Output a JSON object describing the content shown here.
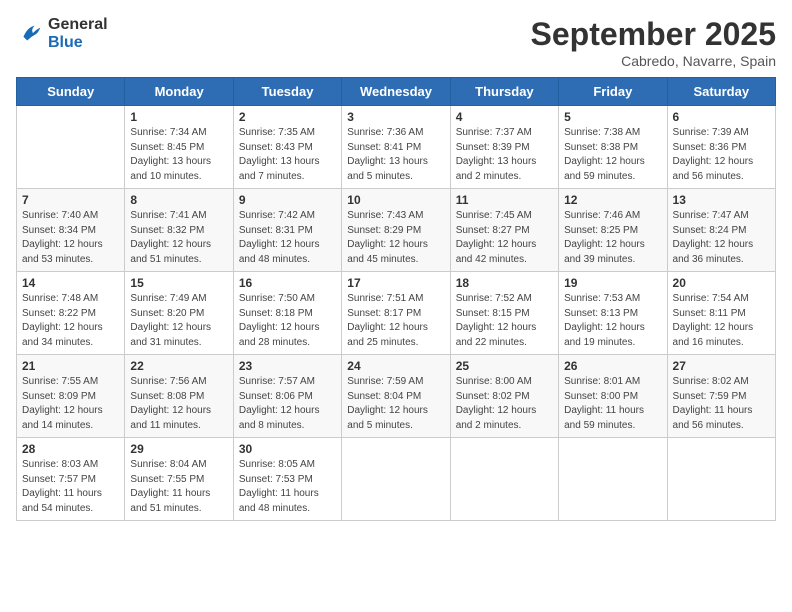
{
  "header": {
    "logo_line1": "General",
    "logo_line2": "Blue",
    "month": "September 2025",
    "location": "Cabredo, Navarre, Spain"
  },
  "days_of_week": [
    "Sunday",
    "Monday",
    "Tuesday",
    "Wednesday",
    "Thursday",
    "Friday",
    "Saturday"
  ],
  "weeks": [
    [
      {
        "day": "",
        "sunrise": "",
        "sunset": "",
        "daylight": ""
      },
      {
        "day": "1",
        "sunrise": "Sunrise: 7:34 AM",
        "sunset": "Sunset: 8:45 PM",
        "daylight": "Daylight: 13 hours and 10 minutes."
      },
      {
        "day": "2",
        "sunrise": "Sunrise: 7:35 AM",
        "sunset": "Sunset: 8:43 PM",
        "daylight": "Daylight: 13 hours and 7 minutes."
      },
      {
        "day": "3",
        "sunrise": "Sunrise: 7:36 AM",
        "sunset": "Sunset: 8:41 PM",
        "daylight": "Daylight: 13 hours and 5 minutes."
      },
      {
        "day": "4",
        "sunrise": "Sunrise: 7:37 AM",
        "sunset": "Sunset: 8:39 PM",
        "daylight": "Daylight: 13 hours and 2 minutes."
      },
      {
        "day": "5",
        "sunrise": "Sunrise: 7:38 AM",
        "sunset": "Sunset: 8:38 PM",
        "daylight": "Daylight: 12 hours and 59 minutes."
      },
      {
        "day": "6",
        "sunrise": "Sunrise: 7:39 AM",
        "sunset": "Sunset: 8:36 PM",
        "daylight": "Daylight: 12 hours and 56 minutes."
      }
    ],
    [
      {
        "day": "7",
        "sunrise": "Sunrise: 7:40 AM",
        "sunset": "Sunset: 8:34 PM",
        "daylight": "Daylight: 12 hours and 53 minutes."
      },
      {
        "day": "8",
        "sunrise": "Sunrise: 7:41 AM",
        "sunset": "Sunset: 8:32 PM",
        "daylight": "Daylight: 12 hours and 51 minutes."
      },
      {
        "day": "9",
        "sunrise": "Sunrise: 7:42 AM",
        "sunset": "Sunset: 8:31 PM",
        "daylight": "Daylight: 12 hours and 48 minutes."
      },
      {
        "day": "10",
        "sunrise": "Sunrise: 7:43 AM",
        "sunset": "Sunset: 8:29 PM",
        "daylight": "Daylight: 12 hours and 45 minutes."
      },
      {
        "day": "11",
        "sunrise": "Sunrise: 7:45 AM",
        "sunset": "Sunset: 8:27 PM",
        "daylight": "Daylight: 12 hours and 42 minutes."
      },
      {
        "day": "12",
        "sunrise": "Sunrise: 7:46 AM",
        "sunset": "Sunset: 8:25 PM",
        "daylight": "Daylight: 12 hours and 39 minutes."
      },
      {
        "day": "13",
        "sunrise": "Sunrise: 7:47 AM",
        "sunset": "Sunset: 8:24 PM",
        "daylight": "Daylight: 12 hours and 36 minutes."
      }
    ],
    [
      {
        "day": "14",
        "sunrise": "Sunrise: 7:48 AM",
        "sunset": "Sunset: 8:22 PM",
        "daylight": "Daylight: 12 hours and 34 minutes."
      },
      {
        "day": "15",
        "sunrise": "Sunrise: 7:49 AM",
        "sunset": "Sunset: 8:20 PM",
        "daylight": "Daylight: 12 hours and 31 minutes."
      },
      {
        "day": "16",
        "sunrise": "Sunrise: 7:50 AM",
        "sunset": "Sunset: 8:18 PM",
        "daylight": "Daylight: 12 hours and 28 minutes."
      },
      {
        "day": "17",
        "sunrise": "Sunrise: 7:51 AM",
        "sunset": "Sunset: 8:17 PM",
        "daylight": "Daylight: 12 hours and 25 minutes."
      },
      {
        "day": "18",
        "sunrise": "Sunrise: 7:52 AM",
        "sunset": "Sunset: 8:15 PM",
        "daylight": "Daylight: 12 hours and 22 minutes."
      },
      {
        "day": "19",
        "sunrise": "Sunrise: 7:53 AM",
        "sunset": "Sunset: 8:13 PM",
        "daylight": "Daylight: 12 hours and 19 minutes."
      },
      {
        "day": "20",
        "sunrise": "Sunrise: 7:54 AM",
        "sunset": "Sunset: 8:11 PM",
        "daylight": "Daylight: 12 hours and 16 minutes."
      }
    ],
    [
      {
        "day": "21",
        "sunrise": "Sunrise: 7:55 AM",
        "sunset": "Sunset: 8:09 PM",
        "daylight": "Daylight: 12 hours and 14 minutes."
      },
      {
        "day": "22",
        "sunrise": "Sunrise: 7:56 AM",
        "sunset": "Sunset: 8:08 PM",
        "daylight": "Daylight: 12 hours and 11 minutes."
      },
      {
        "day": "23",
        "sunrise": "Sunrise: 7:57 AM",
        "sunset": "Sunset: 8:06 PM",
        "daylight": "Daylight: 12 hours and 8 minutes."
      },
      {
        "day": "24",
        "sunrise": "Sunrise: 7:59 AM",
        "sunset": "Sunset: 8:04 PM",
        "daylight": "Daylight: 12 hours and 5 minutes."
      },
      {
        "day": "25",
        "sunrise": "Sunrise: 8:00 AM",
        "sunset": "Sunset: 8:02 PM",
        "daylight": "Daylight: 12 hours and 2 minutes."
      },
      {
        "day": "26",
        "sunrise": "Sunrise: 8:01 AM",
        "sunset": "Sunset: 8:00 PM",
        "daylight": "Daylight: 11 hours and 59 minutes."
      },
      {
        "day": "27",
        "sunrise": "Sunrise: 8:02 AM",
        "sunset": "Sunset: 7:59 PM",
        "daylight": "Daylight: 11 hours and 56 minutes."
      }
    ],
    [
      {
        "day": "28",
        "sunrise": "Sunrise: 8:03 AM",
        "sunset": "Sunset: 7:57 PM",
        "daylight": "Daylight: 11 hours and 54 minutes."
      },
      {
        "day": "29",
        "sunrise": "Sunrise: 8:04 AM",
        "sunset": "Sunset: 7:55 PM",
        "daylight": "Daylight: 11 hours and 51 minutes."
      },
      {
        "day": "30",
        "sunrise": "Sunrise: 8:05 AM",
        "sunset": "Sunset: 7:53 PM",
        "daylight": "Daylight: 11 hours and 48 minutes."
      },
      {
        "day": "",
        "sunrise": "",
        "sunset": "",
        "daylight": ""
      },
      {
        "day": "",
        "sunrise": "",
        "sunset": "",
        "daylight": ""
      },
      {
        "day": "",
        "sunrise": "",
        "sunset": "",
        "daylight": ""
      },
      {
        "day": "",
        "sunrise": "",
        "sunset": "",
        "daylight": ""
      }
    ]
  ]
}
